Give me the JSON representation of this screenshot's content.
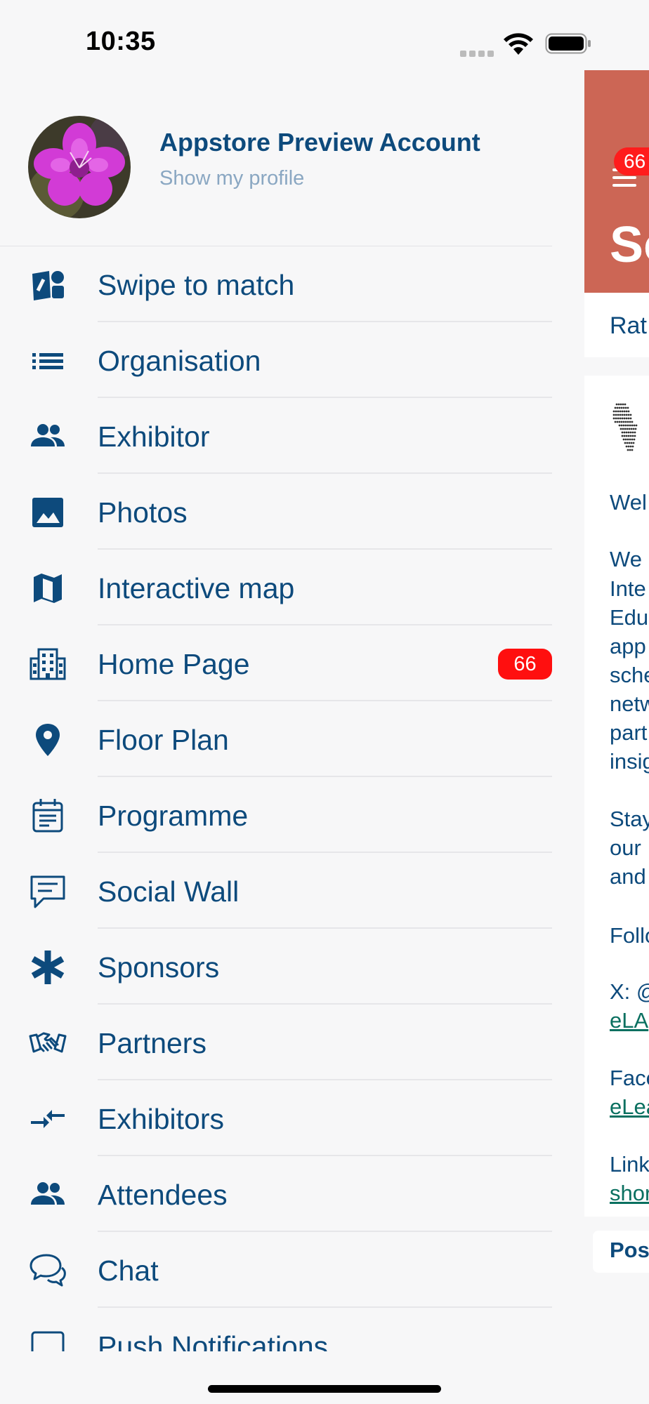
{
  "status_bar": {
    "time": "10:35"
  },
  "profile": {
    "name": "Appstore Preview Account",
    "link_label": "Show my profile"
  },
  "menu": {
    "items": [
      {
        "label": "Swipe to match",
        "icon": "swipe-cards-icon"
      },
      {
        "label": "Organisation",
        "icon": "list-icon"
      },
      {
        "label": "Exhibitor",
        "icon": "people-icon"
      },
      {
        "label": "Photos",
        "icon": "image-icon"
      },
      {
        "label": "Interactive map",
        "icon": "map-icon"
      },
      {
        "label": "Home Page",
        "icon": "building-icon",
        "badge": "66"
      },
      {
        "label": "Floor Plan",
        "icon": "location-pin-icon"
      },
      {
        "label": "Programme",
        "icon": "calendar-icon"
      },
      {
        "label": "Social Wall",
        "icon": "message-icon"
      },
      {
        "label": "Sponsors",
        "icon": "asterisk-icon"
      },
      {
        "label": "Partners",
        "icon": "handshake-icon"
      },
      {
        "label": "Exhibitors",
        "icon": "compare-arrows-icon"
      },
      {
        "label": "Attendees",
        "icon": "people-icon"
      },
      {
        "label": "Chat",
        "icon": "chat-bubbles-icon"
      },
      {
        "label": "Push Notifications",
        "icon": "notification-square-icon"
      }
    ]
  },
  "background_screen": {
    "header_badge": "66",
    "title_fragment": "So",
    "tab_fragment": "Rat",
    "text_lines": [
      {
        "text": "Wel",
        "link": false
      },
      {
        "text": "We",
        "link": false
      },
      {
        "text": "Inte",
        "link": false
      },
      {
        "text": "Edu",
        "link": false
      },
      {
        "text": "app",
        "link": false
      },
      {
        "text": "sche",
        "link": false
      },
      {
        "text": "netw",
        "link": false
      },
      {
        "text": "part",
        "link": false
      },
      {
        "text": "insig",
        "link": false
      },
      {
        "text": "Stay",
        "link": false
      },
      {
        "text": "our",
        "link": false
      },
      {
        "text": "and",
        "link": false
      },
      {
        "text": "Follo",
        "link": false
      },
      {
        "text": "X: @",
        "link": false
      },
      {
        "text": "eLA",
        "link": true
      },
      {
        "text": "Face",
        "link": false
      },
      {
        "text": "eLea",
        "link": true
      },
      {
        "text": "Link",
        "link": false
      },
      {
        "text": "shor",
        "link": true
      }
    ],
    "post_label": "Pos"
  },
  "colors": {
    "primary_text": "#0d4a7c",
    "header_background": "#cc6655",
    "badge": "#ff0f0f",
    "link": "#0a7060"
  }
}
